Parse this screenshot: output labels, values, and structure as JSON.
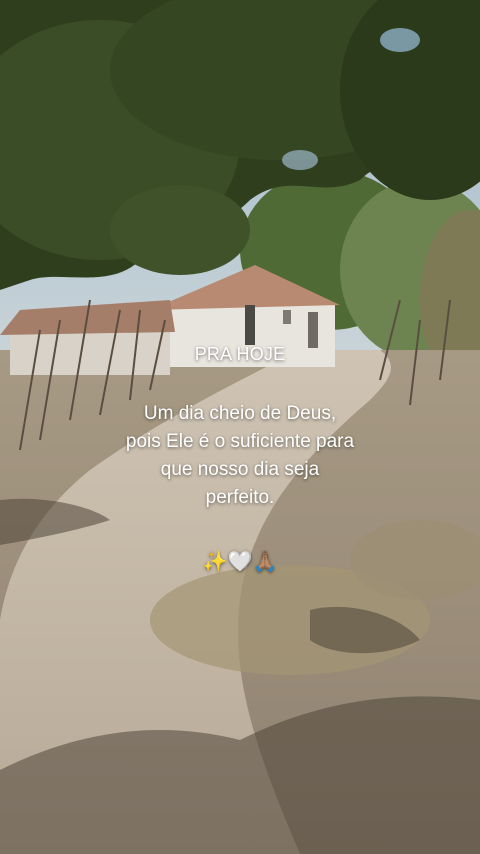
{
  "headline": "PRA HOJE",
  "message_lines": [
    "Um dia cheio de Deus,",
    "pois Ele é o suficiente para",
    "que nosso dia seja",
    "perfeito."
  ],
  "emojis": "✨🤍🙏🏽",
  "colors": {
    "text": "#ffffff",
    "foliage": "#2f3f1e",
    "dirt_road": "#b9ab97",
    "house_wall": "#e8e4de",
    "roof": "#b98a72"
  }
}
